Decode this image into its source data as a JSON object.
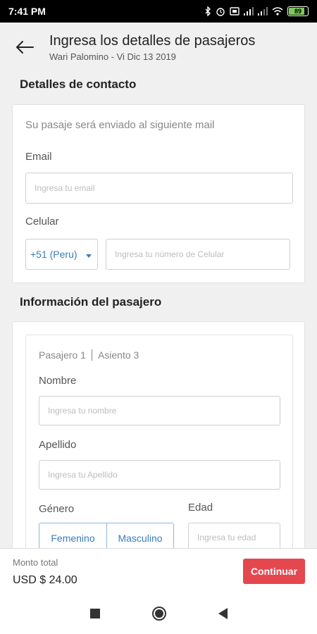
{
  "status_bar": {
    "time": "7:41 PM",
    "battery_level": "89",
    "icons": [
      "bluetooth-icon",
      "alarm-icon",
      "sim-icon",
      "signal-icon",
      "signal-icon",
      "wifi-icon",
      "battery-icon"
    ]
  },
  "header": {
    "title": "Ingresa los detalles de pasajeros",
    "subtitle": "Wari Palomino - Vi Dic 13 2019"
  },
  "contact": {
    "section_title": "Detalles de contacto",
    "note": "Su pasaje será enviado al siguiente mail",
    "email_label": "Email",
    "email_placeholder": "Ingresa tu email",
    "phone_label": "Celular",
    "country_code": "+51 (Peru)",
    "phone_placeholder": "Ingresa tu número de Celular"
  },
  "passenger": {
    "section_title": "Información del pasajero",
    "passenger_label": "Pasajero 1",
    "seat_label": "Asiento 3",
    "first_name_label": "Nombre",
    "first_name_placeholder": "Ingresa tu nombre",
    "last_name_label": "Apellido",
    "last_name_placeholder": "Ingresa tu Apellido",
    "gender_label": "Género",
    "gender_options": [
      "Femenino",
      "Masculino"
    ],
    "age_label": "Edad",
    "age_placeholder": "Ingresa tu edad"
  },
  "footer": {
    "total_label": "Monto total",
    "total_value": "USD $ 24.00",
    "continue_label": "Continuar"
  },
  "colors": {
    "accent_blue": "#3b7bbf",
    "continue_red": "#e5474f",
    "battery_green": "#7ec95a"
  }
}
